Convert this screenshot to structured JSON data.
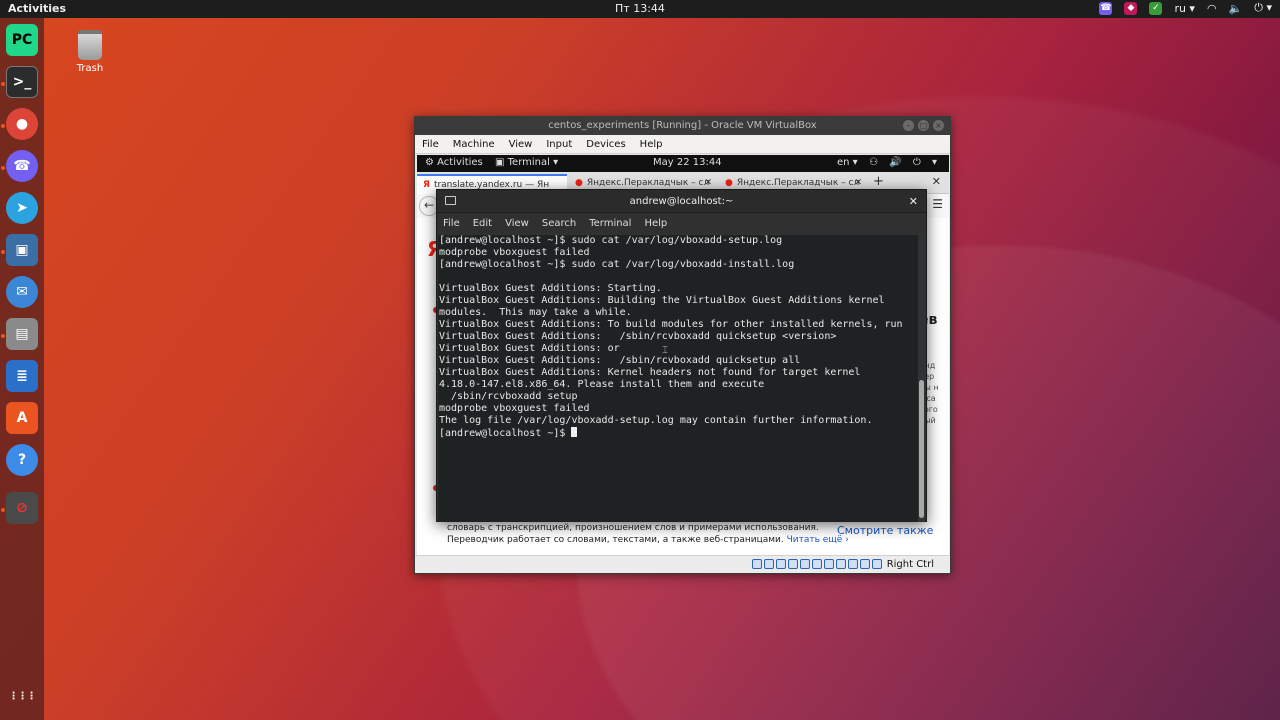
{
  "topbar": {
    "activities": "Activities",
    "clock": "Пт 13:44",
    "lang": "ru ▾",
    "tray_icons": [
      "viber-tray-icon",
      "app-tray-icon",
      "shield-tray-icon",
      "network-icon",
      "volume-icon",
      "power-icon"
    ]
  },
  "dock": {
    "items": [
      {
        "name": "pycharm",
        "label": "PC",
        "color": "#21d789"
      },
      {
        "name": "terminal",
        "label": ">_",
        "color": "#2c2c2c"
      },
      {
        "name": "chrome",
        "label": "●",
        "color": "#db4437"
      },
      {
        "name": "viber",
        "label": "☎",
        "color": "#7360f2"
      },
      {
        "name": "telegram",
        "label": "➤",
        "color": "#2aa3e0"
      },
      {
        "name": "virtualbox",
        "label": "▣",
        "color": "#3a6ea5"
      },
      {
        "name": "thunderbird",
        "label": "✉",
        "color": "#3b87d6"
      },
      {
        "name": "files",
        "label": "▤",
        "color": "#8a8a8a"
      },
      {
        "name": "libreoffice-writer",
        "label": "≣",
        "color": "#2a70c8"
      },
      {
        "name": "software-center",
        "label": "A",
        "color": "#e95420"
      },
      {
        "name": "help",
        "label": "?",
        "color": "#3c8ce7"
      },
      {
        "name": "vm-stop",
        "label": "⊘",
        "color": "#4a4a4a"
      }
    ],
    "show_apps_label": "⋮⋮⋮"
  },
  "desktop": {
    "trash_label": "Trash"
  },
  "vbox": {
    "title": "centos_experiments [Running] - Oracle VM VirtualBox",
    "menu": [
      "File",
      "Machine",
      "View",
      "Input",
      "Devices",
      "Help"
    ],
    "host_key": "Right Ctrl"
  },
  "guest": {
    "activities": "⚙ Activities",
    "terminal_menu": "▣ Terminal ▾",
    "clock": "May 22  13:44",
    "lang": "en ▾",
    "tray": "⚇ 🔊 ⏻ ▾",
    "tabs": [
      {
        "label": "translate.yandex.ru — Ян",
        "icon": "Я"
      },
      {
        "label": "Яндекс.Перакладчык – сл",
        "icon": "●"
      },
      {
        "label": "Яндекс.Перакладчык – сл",
        "icon": "●"
      }
    ],
    "new_tab": "+",
    "close_window": "✕",
    "back": "←",
    "menu": "☰",
    "logo": "Я",
    "right_text": [
      "ев",
      "",
      "Янд",
      "пер",
      "ды н",
      "я са",
      "кого",
      "ный"
    ],
    "footer_line1": "словарь с транскрипцией, произношением слов и примерами использования.",
    "footer_line2": "Переводчик работает со словами, текстами, а также веб-страницами.",
    "footer_link": "Читать ещё ›",
    "see_also": "Смотрите также"
  },
  "terminal": {
    "title": "andrew@localhost:~",
    "menu": [
      "File",
      "Edit",
      "View",
      "Search",
      "Terminal",
      "Help"
    ],
    "lines": [
      "[andrew@localhost ~]$ sudo cat /var/log/vboxadd-setup.log",
      "modprobe vboxguest failed",
      "[andrew@localhost ~]$ sudo cat /var/log/vboxadd-install.log",
      "",
      "VirtualBox Guest Additions: Starting.",
      "VirtualBox Guest Additions: Building the VirtualBox Guest Additions kernel",
      "modules.  This may take a while.",
      "VirtualBox Guest Additions: To build modules for other installed kernels, run",
      "VirtualBox Guest Additions:   /sbin/rcvboxadd quicksetup <version>",
      "VirtualBox Guest Additions: or",
      "VirtualBox Guest Additions:   /sbin/rcvboxadd quicksetup all",
      "VirtualBox Guest Additions: Kernel headers not found for target kernel",
      "4.18.0-147.el8.x86_64. Please install them and execute",
      "  /sbin/rcvboxadd setup",
      "modprobe vboxguest failed",
      "The log file /var/log/vboxadd-setup.log may contain further information."
    ],
    "prompt": "[andrew@localhost ~]$ "
  }
}
